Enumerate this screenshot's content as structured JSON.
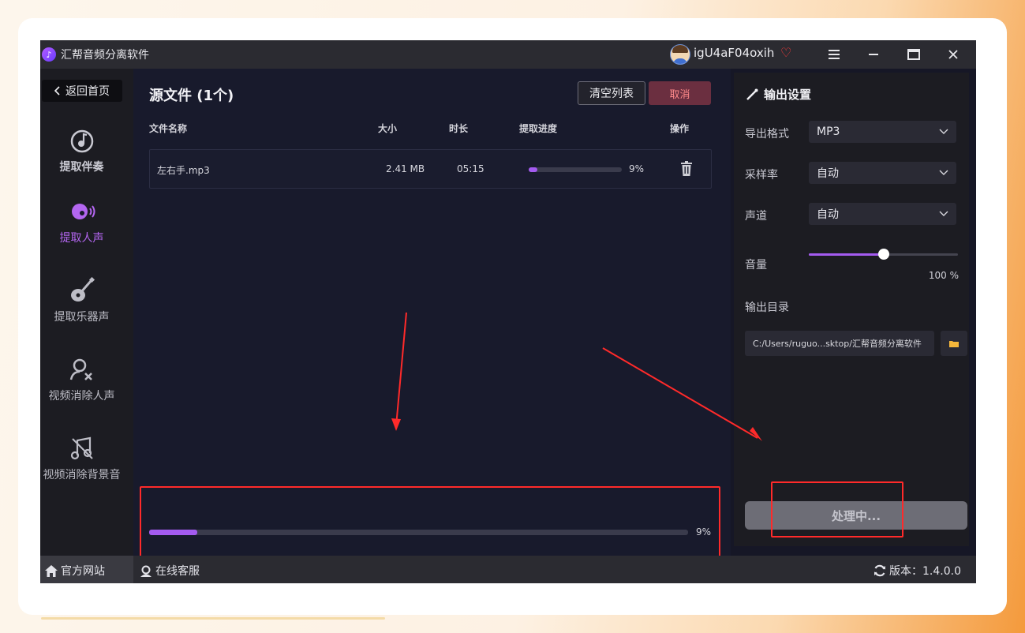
{
  "app": {
    "title": "汇帮音频分离软件",
    "username": "igU4aF04oxih"
  },
  "sidebar": {
    "back_label": "返回首页",
    "items": [
      {
        "label": "提取伴奏",
        "icon": "music-disc-icon"
      },
      {
        "label": "提取人声",
        "icon": "voice-icon"
      },
      {
        "label": "提取乐器声",
        "icon": "guitar-icon"
      },
      {
        "label": "视频消除人声",
        "icon": "user-remove-icon"
      },
      {
        "label": "视频消除背景音",
        "icon": "music-mute-icon"
      }
    ]
  },
  "main": {
    "title": "源文件 (1个)",
    "clear_label": "清空列表",
    "cancel_label": "取消",
    "columns": [
      "文件名称",
      "大小",
      "时长",
      "提取进度",
      "操作"
    ],
    "files": [
      {
        "name": "左右手.mp3",
        "size": "2.41 MB",
        "duration": "05:15",
        "progress": 9,
        "progress_text": "9%"
      }
    ],
    "overall_progress": 9,
    "overall_progress_text": "9%"
  },
  "output": {
    "title": "输出设置",
    "format_label": "导出格式",
    "format_value": "MP3",
    "samplerate_label": "采样率",
    "samplerate_value": "自动",
    "channel_label": "声道",
    "channel_value": "自动",
    "volume_label": "音量",
    "volume_value": 50,
    "volume_text": "100 %",
    "dir_label": "输出目录",
    "dir_value": "C:/Users/ruguo...sktop/汇帮音频分离软件",
    "process_label": "处理中..."
  },
  "statusbar": {
    "website": "官方网站",
    "support": "在线客服",
    "version": "版本：1.4.0.0"
  },
  "colors": {
    "accent": "#a45bf0",
    "annotation": "#ff2a2a"
  }
}
